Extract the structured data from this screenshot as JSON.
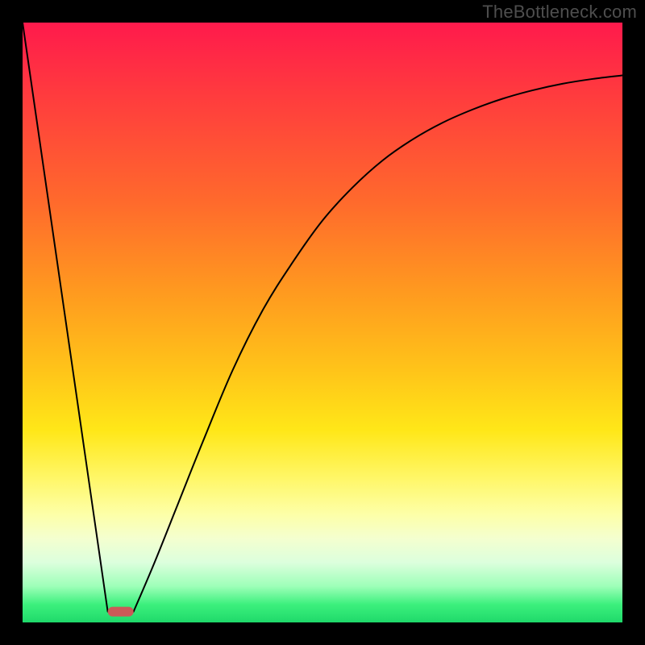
{
  "watermark": "TheBottleneck.com",
  "chart_data": {
    "type": "line",
    "title": "",
    "xlabel": "",
    "ylabel": "",
    "xlim": [
      0,
      100
    ],
    "ylim": [
      0,
      100
    ],
    "grid": false,
    "legend": false,
    "annotations": [],
    "series": [
      {
        "name": "left-descent",
        "x": [
          0,
          14.2
        ],
        "values": [
          100,
          1.8
        ]
      },
      {
        "name": "right-ascent",
        "x": [
          18.5,
          22,
          26,
          30,
          35,
          40,
          45,
          50,
          55,
          60,
          65,
          70,
          75,
          80,
          85,
          90,
          95,
          100
        ],
        "values": [
          1.8,
          10,
          20,
          30,
          42,
          52,
          60,
          67,
          72.5,
          77,
          80.5,
          83.3,
          85.5,
          87.3,
          88.7,
          89.8,
          90.6,
          91.2
        ]
      }
    ],
    "marker": {
      "name": "optimal-marker",
      "x_start": 14.2,
      "x_end": 18.5,
      "y": 1.8,
      "color": "#cb5a58"
    },
    "gradient_stops": [
      {
        "pos": 0.0,
        "color": "#ff1a4c"
      },
      {
        "pos": 0.12,
        "color": "#ff3b3e"
      },
      {
        "pos": 0.3,
        "color": "#ff6a2c"
      },
      {
        "pos": 0.45,
        "color": "#ff9a1f"
      },
      {
        "pos": 0.58,
        "color": "#ffc419"
      },
      {
        "pos": 0.68,
        "color": "#ffe718"
      },
      {
        "pos": 0.76,
        "color": "#fff768"
      },
      {
        "pos": 0.82,
        "color": "#fdffa8"
      },
      {
        "pos": 0.86,
        "color": "#f4ffcf"
      },
      {
        "pos": 0.9,
        "color": "#dcffdd"
      },
      {
        "pos": 0.94,
        "color": "#9dffb8"
      },
      {
        "pos": 0.97,
        "color": "#3cf07d"
      },
      {
        "pos": 1.0,
        "color": "#1fd96a"
      }
    ]
  }
}
